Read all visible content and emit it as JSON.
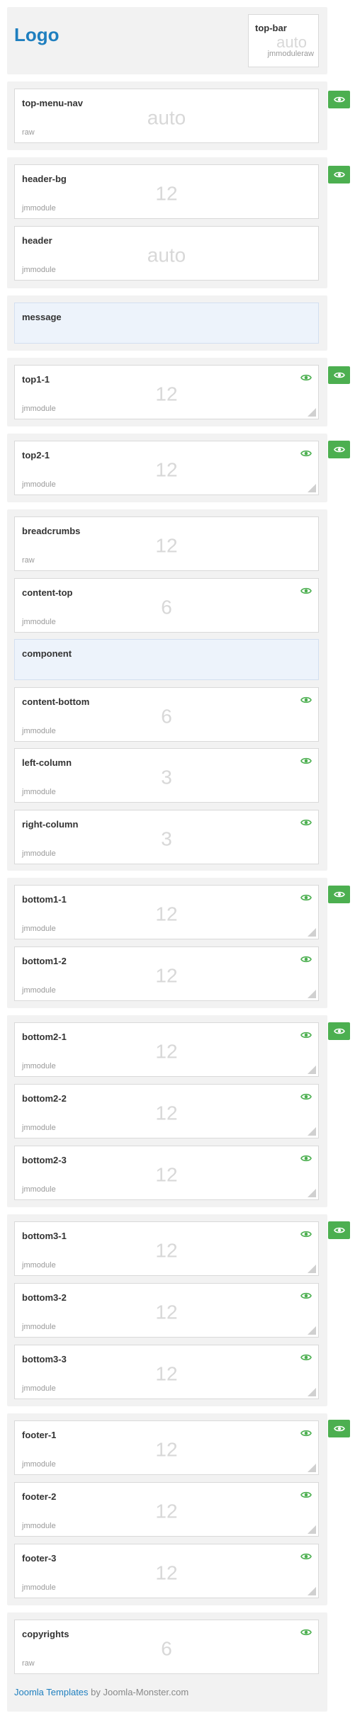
{
  "logo": "Logo",
  "top_bar": {
    "name": "top-bar",
    "size": "auto",
    "type": "jmmoduleraw"
  },
  "top_menu_nav": {
    "name": "top-menu-nav",
    "size": "auto",
    "type": "raw"
  },
  "header_bg": {
    "name": "header-bg",
    "size": "12",
    "type": "jmmodule"
  },
  "header": {
    "name": "header",
    "size": "auto",
    "type": "jmmodule"
  },
  "message": {
    "name": "message"
  },
  "top1_1": {
    "name": "top1-1",
    "size": "12",
    "type": "jmmodule"
  },
  "top2_1": {
    "name": "top2-1",
    "size": "12",
    "type": "jmmodule"
  },
  "breadcrumbs": {
    "name": "breadcrumbs",
    "size": "12",
    "type": "raw"
  },
  "content_top": {
    "name": "content-top",
    "size": "6",
    "type": "jmmodule"
  },
  "component": {
    "name": "component"
  },
  "content_bottom": {
    "name": "content-bottom",
    "size": "6",
    "type": "jmmodule"
  },
  "left_column": {
    "name": "left-column",
    "size": "3",
    "type": "jmmodule"
  },
  "right_column": {
    "name": "right-column",
    "size": "3",
    "type": "jmmodule"
  },
  "bottom1_1": {
    "name": "bottom1-1",
    "size": "12",
    "type": "jmmodule"
  },
  "bottom1_2": {
    "name": "bottom1-2",
    "size": "12",
    "type": "jmmodule"
  },
  "bottom2_1": {
    "name": "bottom2-1",
    "size": "12",
    "type": "jmmodule"
  },
  "bottom2_2": {
    "name": "bottom2-2",
    "size": "12",
    "type": "jmmodule"
  },
  "bottom2_3": {
    "name": "bottom2-3",
    "size": "12",
    "type": "jmmodule"
  },
  "bottom3_1": {
    "name": "bottom3-1",
    "size": "12",
    "type": "jmmodule"
  },
  "bottom3_2": {
    "name": "bottom3-2",
    "size": "12",
    "type": "jmmodule"
  },
  "bottom3_3": {
    "name": "bottom3-3",
    "size": "12",
    "type": "jmmodule"
  },
  "footer_1": {
    "name": "footer-1",
    "size": "12",
    "type": "jmmodule"
  },
  "footer_2": {
    "name": "footer-2",
    "size": "12",
    "type": "jmmodule"
  },
  "footer_3": {
    "name": "footer-3",
    "size": "12",
    "type": "jmmodule"
  },
  "copyrights": {
    "name": "copyrights",
    "size": "6",
    "type": "raw"
  },
  "footer_note": {
    "link": "Joomla Templates",
    "rest": "by Joomla-Monster.com"
  },
  "colors": {
    "accent_green": "#4caf50",
    "logo_blue": "#1f7fbf"
  },
  "icons": {
    "visibility": "eye-icon",
    "resize": "resize-handle-icon"
  }
}
